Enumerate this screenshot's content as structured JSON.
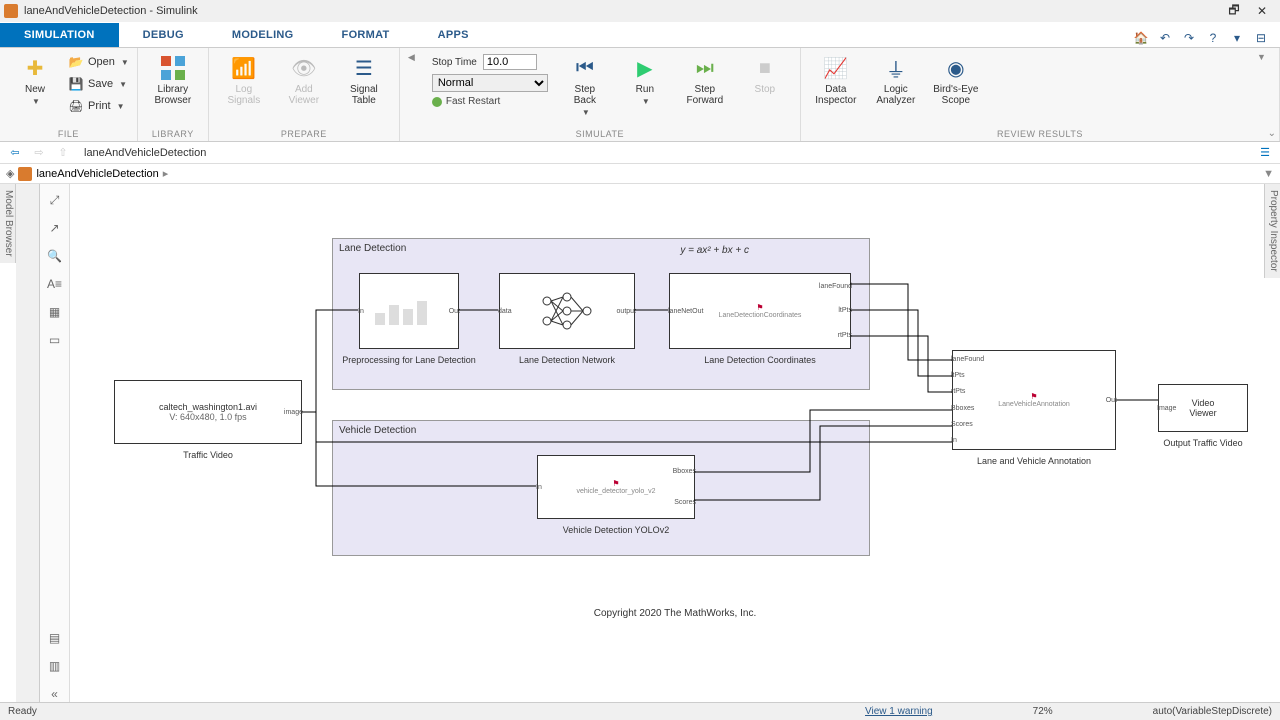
{
  "title": {
    "app": "laneAndVehicleDetection",
    "suffix": "Simulink"
  },
  "tabs": [
    "SIMULATION",
    "DEBUG",
    "MODELING",
    "FORMAT",
    "APPS"
  ],
  "active_tab": 0,
  "file": {
    "new": "New",
    "open": "Open",
    "save": "Save",
    "print": "Print",
    "group": "FILE"
  },
  "library": {
    "btn": "Library\nBrowser",
    "group": "LIBRARY"
  },
  "prepare": {
    "log": "Log\nSignals",
    "add": "Add\nViewer",
    "table": "Signal\nTable",
    "group": "PREPARE"
  },
  "sim": {
    "stop_label": "Stop Time",
    "stop_value": "10.0",
    "mode": "Normal",
    "fast": "Fast Restart",
    "back": "Step\nBack",
    "run": "Run",
    "fwd": "Step\nForward",
    "stop": "Stop",
    "group": "SIMULATE"
  },
  "review": {
    "di": "Data\nInspector",
    "la": "Logic\nAnalyzer",
    "be": "Bird's-Eye\nScope",
    "group": "REVIEW RESULTS"
  },
  "nav": {
    "title": "laneAndVehicleDetection"
  },
  "breadcrumb": "laneAndVehicleDetection",
  "left_tab": "Model Browser",
  "right_tab": "Property Inspector",
  "subsystems": {
    "lane": {
      "title": "Lane Detection",
      "eq": "y = ax² + bx + c"
    },
    "vehicle": {
      "title": "Vehicle Detection"
    }
  },
  "blocks": {
    "traffic": {
      "line1": "caltech_washington1.avi",
      "line2": "V: 640x480, 1.0 fps",
      "label": "Traffic Video"
    },
    "prep": {
      "label": "Preprocessing for Lane Detection",
      "pin": "In",
      "pout": "Out"
    },
    "net": {
      "label": "Lane Detection Network",
      "pin": "data",
      "pout": "output"
    },
    "coord": {
      "label": "Lane Detection Coordinates",
      "pin": "laneNetOut",
      "pouts": [
        "laneFound",
        "ltPts",
        "rtPts"
      ]
    },
    "vdet": {
      "label": "Vehicle Detection YOLOv2",
      "pin": "In",
      "pouts": [
        "Bboxes",
        "Scores"
      ]
    },
    "annot": {
      "label": "Lane and Vehicle Annotation",
      "pins": [
        "laneFound",
        "ltPts",
        "rtPts",
        "Bboxes",
        "Scores",
        "In"
      ],
      "pout": "Out",
      "inner": "LaneVehicleAnnotation"
    },
    "viewer": {
      "line1": "Video",
      "line2": "Viewer",
      "label": "Output Traffic Video",
      "pin": "Image"
    }
  },
  "copyright": "Copyright 2020 The MathWorks, Inc.",
  "status": {
    "ready": "Ready",
    "view": "View 1 warning",
    "zoom": "72%",
    "solver": "auto(VariableStepDiscrete)"
  }
}
